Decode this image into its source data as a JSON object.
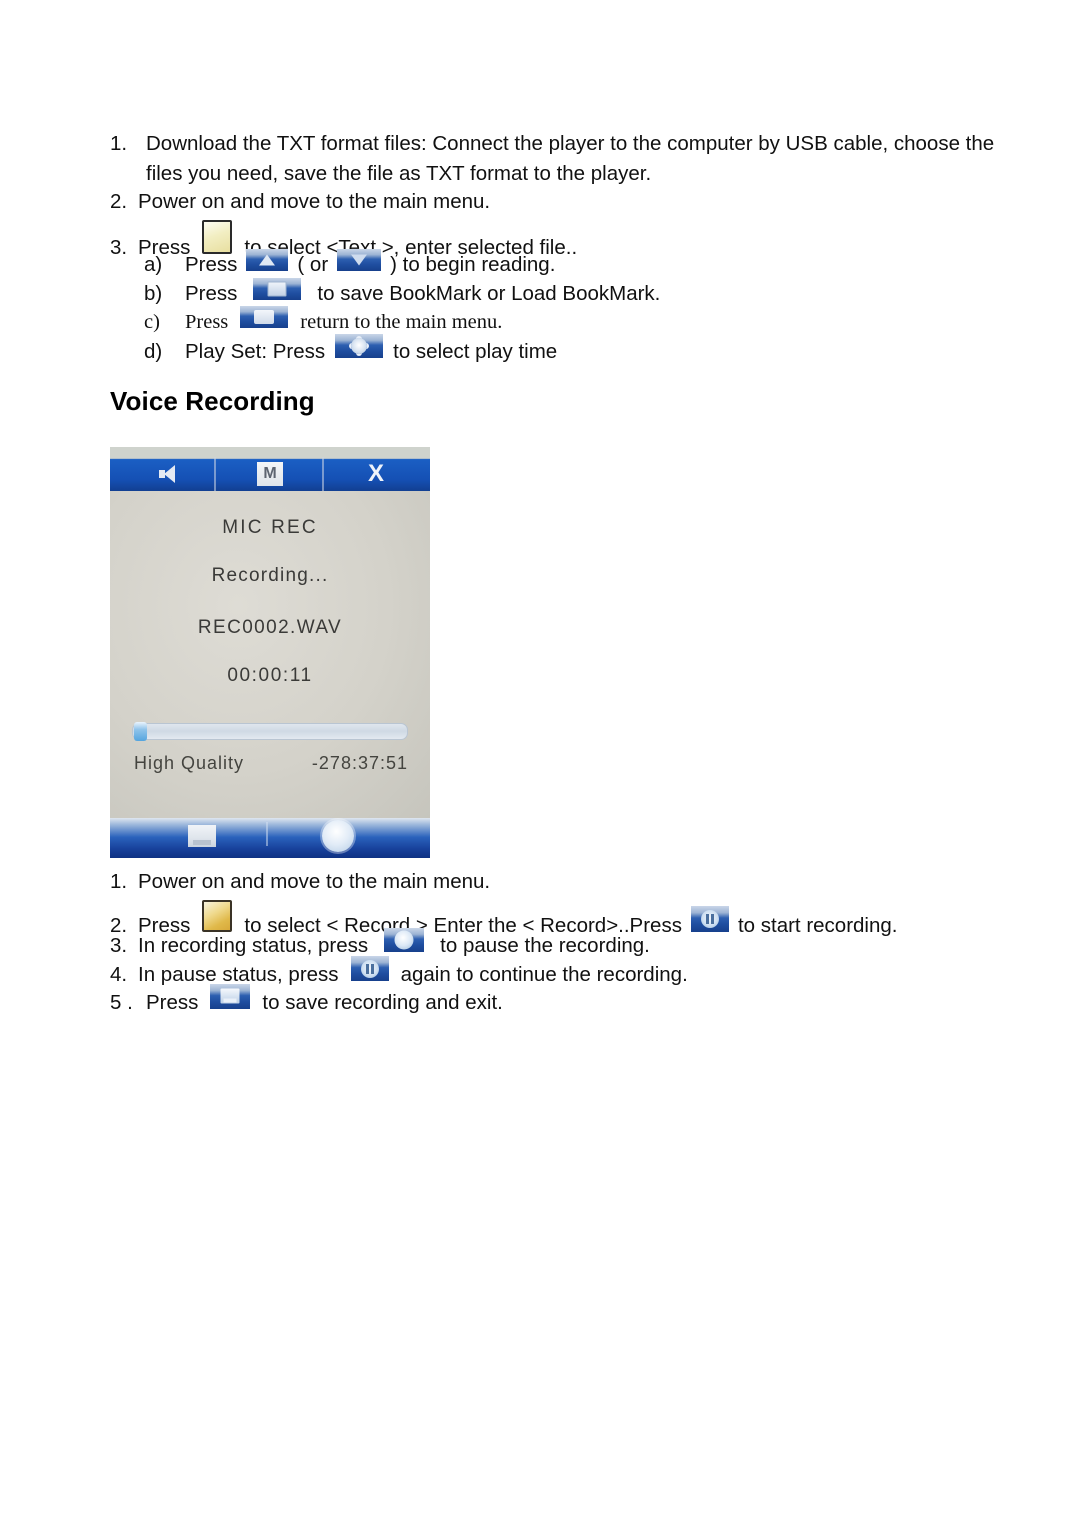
{
  "document": {
    "top_list": [
      {
        "marker": "1.",
        "lines": [
          "Download the TXT format files: Connect the player to the computer by USB cable, choose the",
          "files you need, save the file as TXT format to the player."
        ]
      },
      {
        "marker": "2.",
        "lines": [
          "Power on and move to the main menu."
        ]
      },
      {
        "marker": "3.",
        "before_icon": "Press",
        "icon": "text-mode-button-icon",
        "after_icon": "to select <Text >, enter selected file.."
      }
    ],
    "sub_list": [
      {
        "marker": "a)",
        "before_icon": "Press",
        "icon": "up-arrow-button-icon",
        "middle": "( or",
        "icon2": "down-arrow-button-icon",
        "after_icon": ") to begin reading."
      },
      {
        "marker": "b)",
        "before_icon": "Press",
        "icon": "bookmark-button-icon",
        "after_icon": "to save BookMark or Load BookMark."
      },
      {
        "marker": "c)",
        "before_icon": "Press",
        "icon": "return-button-icon",
        "after_icon": "return to the main menu."
      },
      {
        "marker": "d)",
        "before_icon": "Play Set: Press",
        "icon": "play-set-gear-button-icon",
        "after_icon": "to select play time"
      }
    ],
    "heading": "Voice Recording",
    "bottom_list": [
      {
        "marker": "1.",
        "text": "Power on and move to the main menu."
      },
      {
        "marker": "2.",
        "before_icon": "Press",
        "icon": "record-mode-button-icon",
        "middle": "to select < Record > Enter the < Record>..Press",
        "icon2": "record-start-button-icon",
        "after_icon": "to start recording."
      },
      {
        "marker": "3.",
        "before_icon": "In recording status, press",
        "icon": "pause-circle-button-icon",
        "after_icon": "to pause the recording."
      },
      {
        "marker": "4.",
        "before_icon": "In pause status, press",
        "icon": "resume-button-icon",
        "after_icon": "again to continue the recording."
      },
      {
        "marker": "5 .",
        "before_icon": "Press",
        "icon": "save-exit-button-icon",
        "after_icon": "to save recording and exit."
      }
    ]
  },
  "device_screenshot": {
    "top_bar": {
      "speaker_icon": "speaker-icon",
      "menu_badge": "M",
      "close_icon": "X"
    },
    "screen": {
      "title": "MIC REC",
      "status": "Recording...",
      "filename": "REC0002.WAV",
      "elapsed": "00:00:11",
      "quality": "High Quality",
      "remaining": "-278:37:51",
      "progress_percent": 1
    },
    "bottom_bar": {
      "save_icon": "save-icon",
      "record_button_icon": "record-circle-icon"
    }
  },
  "colors": {
    "bar_blue": "#1550b4",
    "lcd_bg": "#d4d2ca",
    "chip_blue": "#2d5fb0",
    "chip_cream": "#efd98c"
  }
}
